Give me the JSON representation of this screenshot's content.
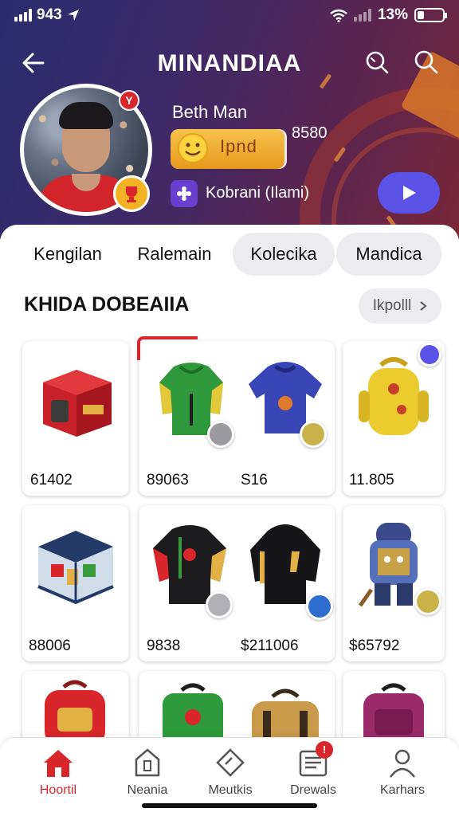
{
  "status_bar": {
    "time": "943",
    "battery": "13%"
  },
  "header": {
    "title": "MINANDIAA"
  },
  "profile": {
    "name": "Beth Man",
    "badge_letter": "Y",
    "xp_label": "Ipnd",
    "xp_progress": 0.98,
    "coins": "8580",
    "clan": "Kobrani (Ilami)"
  },
  "tabs": [
    {
      "label": "Kengilan",
      "active": false
    },
    {
      "label": "Ralemain",
      "active": false
    },
    {
      "label": "Kolecika",
      "active": true
    },
    {
      "label": "Mandica",
      "active": true
    }
  ],
  "section": {
    "title": "KHIDA DOBEAIIA",
    "filter_label": "Ikpolll"
  },
  "items": [
    {
      "price": "61402",
      "item": "red-chest"
    },
    {
      "price": "89063",
      "item": "green-hoodie"
    },
    {
      "price": "S16",
      "item": "blue-jersey"
    },
    {
      "price": "11.805",
      "item": "yellow-backpack"
    },
    {
      "price": "88006",
      "item": "glass-crate"
    },
    {
      "price": "9838",
      "item": "black-jacket"
    },
    {
      "price": "$211006",
      "item": "black-hoodie"
    },
    {
      "price": "$65792",
      "item": "overalls-figure"
    },
    {
      "item": "red-backpack"
    },
    {
      "item": "green-backpack"
    },
    {
      "item": "tan-bag"
    },
    {
      "item": "purple-backpack"
    }
  ],
  "bottom_nav": [
    {
      "label": "Hoortil",
      "icon": "home-icon",
      "active": true
    },
    {
      "label": "Neania",
      "icon": "store-icon",
      "active": false
    },
    {
      "label": "Meutkis",
      "icon": "tag-icon",
      "active": false
    },
    {
      "label": "Drewals",
      "icon": "news-icon",
      "active": false,
      "badge": "!"
    },
    {
      "label": "Karhars",
      "icon": "profile-icon",
      "active": false
    }
  ],
  "colors": {
    "accent": "#5b52e8",
    "brand_red": "#d8262a",
    "xp_gold": "#f4b324"
  }
}
